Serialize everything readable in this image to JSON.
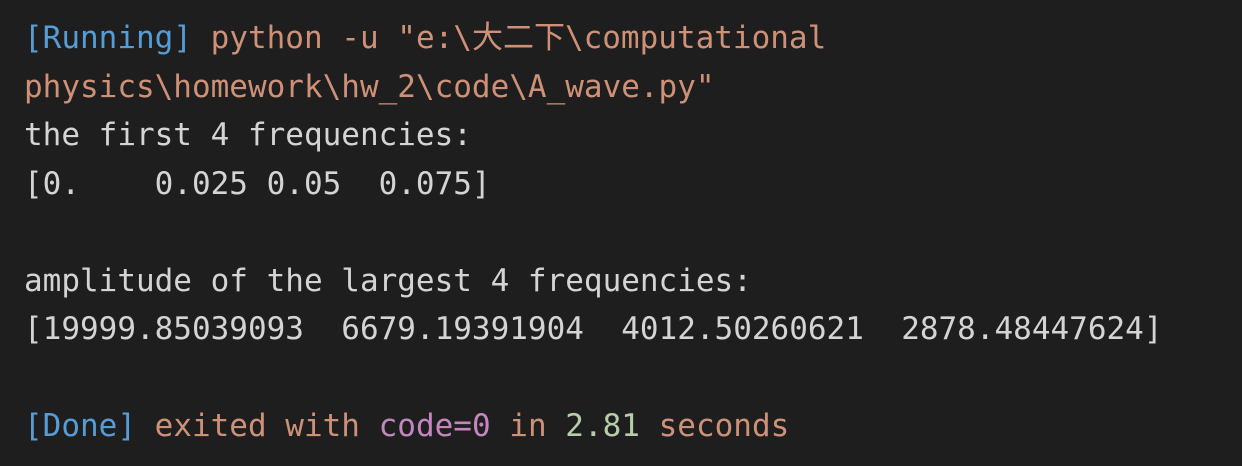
{
  "colors": {
    "background": "#1e1e1e",
    "text": "#d4d4d4",
    "bracket_tag": "#569cd6",
    "command": "#ce9178",
    "code_value": "#c586c0",
    "duration": "#b5cea8"
  },
  "run": {
    "tag": "[Running]",
    "command_line1": "python -u \"e:\\大二下\\computational",
    "command_line2": "physics\\homework\\hw_2\\code\\A_wave.py\""
  },
  "output": {
    "freq_heading": "the first 4 frequencies:",
    "freq_values": "[0.    0.025 0.05  0.075]",
    "amp_heading": "amplitude of the largest 4 frequencies:",
    "amp_values": "[19999.85039093  6679.19391904  4012.50260621  2878.48447624]"
  },
  "done": {
    "tag": "[Done]",
    "exited_with": "exited with",
    "code": "code=0",
    "in": "in",
    "duration": "2.81",
    "unit": "seconds"
  }
}
